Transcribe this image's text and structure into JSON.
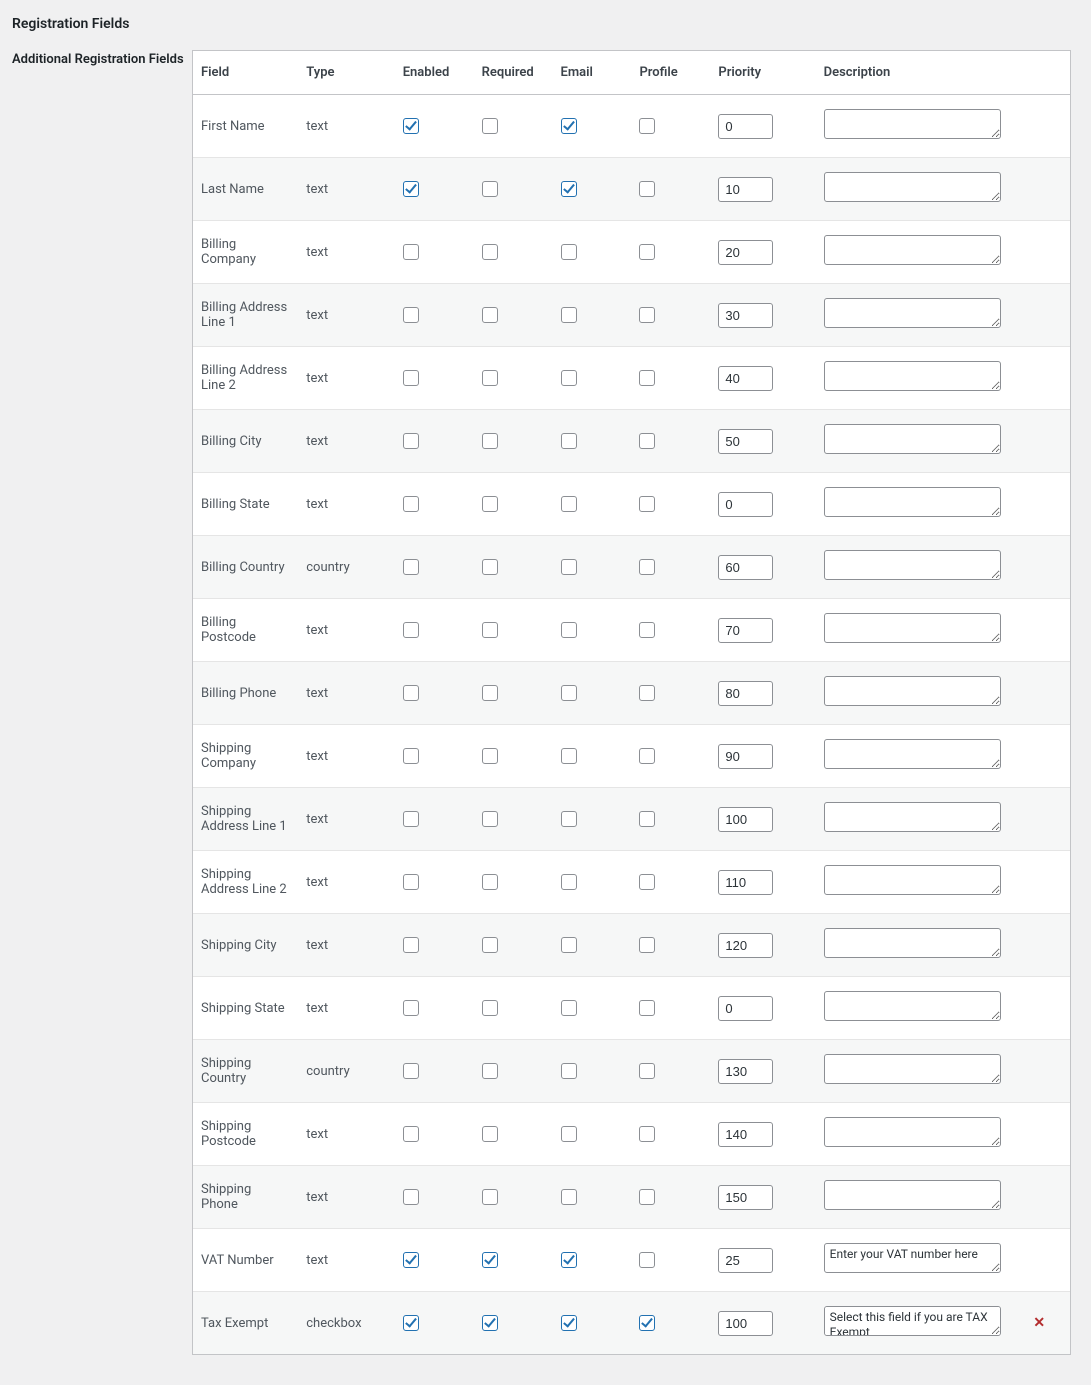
{
  "page": {
    "title": "Registration Fields",
    "side_label": "Additional Registration Fields"
  },
  "columns": {
    "field": "Field",
    "type": "Type",
    "enabled": "Enabled",
    "required": "Required",
    "email": "Email",
    "profile": "Profile",
    "priority": "Priority",
    "description": "Description"
  },
  "rows": [
    {
      "field": "First Name",
      "type": "text",
      "enabled": true,
      "required": false,
      "email": true,
      "profile": false,
      "priority": "0",
      "description": "",
      "removable": false
    },
    {
      "field": "Last Name",
      "type": "text",
      "enabled": true,
      "required": false,
      "email": true,
      "profile": false,
      "priority": "10",
      "description": "",
      "removable": false
    },
    {
      "field": "Billing Company",
      "type": "text",
      "enabled": false,
      "required": false,
      "email": false,
      "profile": false,
      "priority": "20",
      "description": "",
      "removable": false
    },
    {
      "field": "Billing Address Line 1",
      "type": "text",
      "enabled": false,
      "required": false,
      "email": false,
      "profile": false,
      "priority": "30",
      "description": "",
      "removable": false
    },
    {
      "field": "Billing Address Line 2",
      "type": "text",
      "enabled": false,
      "required": false,
      "email": false,
      "profile": false,
      "priority": "40",
      "description": "",
      "removable": false
    },
    {
      "field": "Billing City",
      "type": "text",
      "enabled": false,
      "required": false,
      "email": false,
      "profile": false,
      "priority": "50",
      "description": "",
      "removable": false
    },
    {
      "field": "Billing State",
      "type": "text",
      "enabled": false,
      "required": false,
      "email": false,
      "profile": false,
      "priority": "0",
      "description": "",
      "removable": false
    },
    {
      "field": "Billing Country",
      "type": "country",
      "enabled": false,
      "required": false,
      "email": false,
      "profile": false,
      "priority": "60",
      "description": "",
      "removable": false
    },
    {
      "field": "Billing Postcode",
      "type": "text",
      "enabled": false,
      "required": false,
      "email": false,
      "profile": false,
      "priority": "70",
      "description": "",
      "removable": false
    },
    {
      "field": "Billing Phone",
      "type": "text",
      "enabled": false,
      "required": false,
      "email": false,
      "profile": false,
      "priority": "80",
      "description": "",
      "removable": false
    },
    {
      "field": "Shipping Company",
      "type": "text",
      "enabled": false,
      "required": false,
      "email": false,
      "profile": false,
      "priority": "90",
      "description": "",
      "removable": false
    },
    {
      "field": "Shipping Address Line 1",
      "type": "text",
      "enabled": false,
      "required": false,
      "email": false,
      "profile": false,
      "priority": "100",
      "description": "",
      "removable": false
    },
    {
      "field": "Shipping Address Line 2",
      "type": "text",
      "enabled": false,
      "required": false,
      "email": false,
      "profile": false,
      "priority": "110",
      "description": "",
      "removable": false
    },
    {
      "field": "Shipping City",
      "type": "text",
      "enabled": false,
      "required": false,
      "email": false,
      "profile": false,
      "priority": "120",
      "description": "",
      "removable": false
    },
    {
      "field": "Shipping State",
      "type": "text",
      "enabled": false,
      "required": false,
      "email": false,
      "profile": false,
      "priority": "0",
      "description": "",
      "removable": false
    },
    {
      "field": "Shipping Country",
      "type": "country",
      "enabled": false,
      "required": false,
      "email": false,
      "profile": false,
      "priority": "130",
      "description": "",
      "removable": false
    },
    {
      "field": "Shipping Postcode",
      "type": "text",
      "enabled": false,
      "required": false,
      "email": false,
      "profile": false,
      "priority": "140",
      "description": "",
      "removable": false
    },
    {
      "field": "Shipping Phone",
      "type": "text",
      "enabled": false,
      "required": false,
      "email": false,
      "profile": false,
      "priority": "150",
      "description": "",
      "removable": false
    },
    {
      "field": "VAT Number",
      "type": "text",
      "enabled": true,
      "required": true,
      "email": true,
      "profile": false,
      "priority": "25",
      "description": "Enter your VAT number here",
      "removable": false
    },
    {
      "field": "Tax Exempt",
      "type": "checkbox",
      "enabled": true,
      "required": true,
      "email": true,
      "profile": true,
      "priority": "100",
      "description": "Select this field if you are TAX Exempt",
      "removable": true
    }
  ],
  "icons": {
    "remove": "✕"
  }
}
